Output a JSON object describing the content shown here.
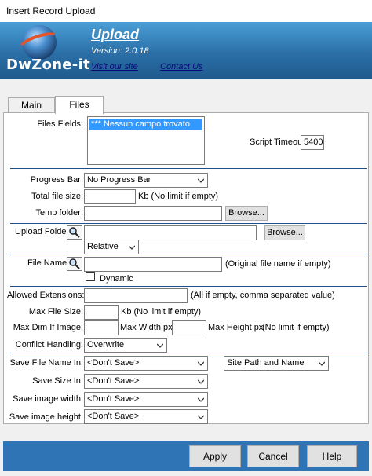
{
  "window": {
    "title": "Insert Record Upload"
  },
  "header": {
    "logo_text": "DwZone-it",
    "title": "Upload",
    "version": "Version: 2.0.18",
    "visit_link": "Visit our site",
    "contact_link": "Contact Us"
  },
  "tabs": [
    {
      "label": "Main",
      "active": false
    },
    {
      "label": "Files",
      "active": true
    }
  ],
  "files_fields": {
    "label": "Files Fields:",
    "items": [
      "*** Nessun campo trovato"
    ]
  },
  "script_timeout": {
    "label": "Script Timeout:",
    "value": "5400"
  },
  "progress_bar": {
    "label": "Progress Bar:",
    "value": "No Progress Bar"
  },
  "total_file_size": {
    "label": "Total file size:",
    "value": "",
    "hint": "Kb (No limit if empty)"
  },
  "temp_folder": {
    "label": "Temp folder:",
    "value": "",
    "browse": "Browse..."
  },
  "upload_folder": {
    "label": "Upload Folder:",
    "value": "",
    "browse": "Browse...",
    "mode": "Relative"
  },
  "file_name": {
    "label": "File Name:",
    "value": "",
    "hint": "(Original file name if empty)",
    "dynamic_label": "Dynamic",
    "dynamic_checked": false
  },
  "allowed_extensions": {
    "label": "Allowed Extensions:",
    "value": "",
    "hint": "(All if empty, comma separated value)"
  },
  "max_file_size": {
    "label": "Max File Size:",
    "value": "",
    "hint": "Kb (No limit if empty)"
  },
  "max_dim": {
    "label": "Max Dim If Image:",
    "width_value": "",
    "width_label": "Max Width px",
    "height_value": "",
    "height_label": "Max Height px",
    "hint": "(No limit if empty)"
  },
  "conflict_handling": {
    "label": "Conflict Handling:",
    "value": "Overwrite"
  },
  "save_file_name": {
    "label": "Save File Name In:",
    "value": "<Don't Save>",
    "path_option": "Site Path and Name"
  },
  "save_size": {
    "label": "Save Size In:",
    "value": "<Don't Save>"
  },
  "save_image_width": {
    "label": "Save image width:",
    "value": "<Don't Save>"
  },
  "save_image_height": {
    "label": "Save image height:",
    "value": "<Don't Save>"
  },
  "footer": {
    "apply": "Apply",
    "cancel": "Cancel",
    "help": "Help"
  },
  "colors": {
    "banner": "#2b6fa8",
    "footer": "#2f74b5",
    "separator": "#1e4f8f",
    "selection": "#3399ff"
  }
}
